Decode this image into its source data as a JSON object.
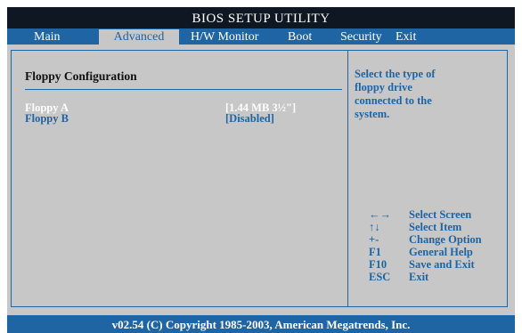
{
  "title": "BIOS SETUP UTILITY",
  "tabs": [
    {
      "label": "Main"
    },
    {
      "label": "Advanced"
    },
    {
      "label": "H/W Monitor"
    },
    {
      "label": "Boot"
    },
    {
      "label": "Security"
    },
    {
      "label": "Exit"
    }
  ],
  "active_tab": "Advanced",
  "section_title": "Floppy Configuration",
  "options": [
    {
      "label": "Floppy A",
      "value": "[1.44 MB 3½\"]",
      "selected": true
    },
    {
      "label": "Floppy B",
      "value": "[Disabled]",
      "selected": false
    }
  ],
  "help_text": [
    "Select the type of",
    "floppy drive",
    "connected to the",
    "system."
  ],
  "key_help": [
    {
      "key": "←→",
      "desc": "Select Screen"
    },
    {
      "key": "↑↓",
      "desc": "Select Item"
    },
    {
      "key": "+-",
      "desc": "Change Option"
    },
    {
      "key": "F1",
      "desc": "General Help"
    },
    {
      "key": "F10",
      "desc": "Save and Exit"
    },
    {
      "key": "ESC",
      "desc": "Exit"
    }
  ],
  "footer": "v02.54 (C) Copyright 1985-2003, American Megatrends, Inc.",
  "colors": {
    "background": "#c7c7c7",
    "accent": "#1f64a3",
    "header": "#0f1822",
    "highlight": "#ffffff"
  }
}
